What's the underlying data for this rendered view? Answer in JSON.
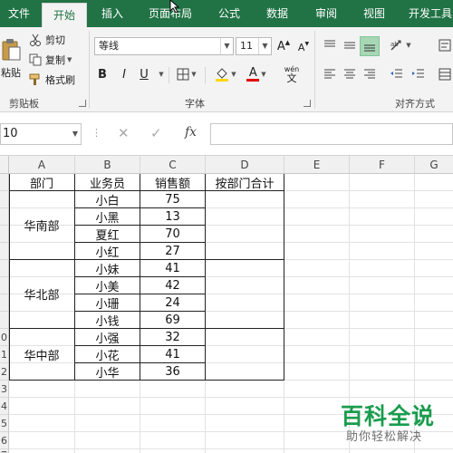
{
  "tabs": [
    "文件",
    "开始",
    "插入",
    "页面布局",
    "公式",
    "数据",
    "审阅",
    "视图",
    "开发工具"
  ],
  "clipboard": {
    "paste_label": "粘贴",
    "cut_label": "剪切",
    "copy_label": "复制",
    "format_painter_label": "格式刷",
    "group_label": "剪贴板"
  },
  "font": {
    "name": "等线",
    "size": "11",
    "bold": "B",
    "italic": "I",
    "underline": "U",
    "grow": "A",
    "shrink": "A",
    "wen": "wén",
    "wen_char": "文",
    "group_label": "字体",
    "color_letter": "A"
  },
  "alignment": {
    "group_label": "对齐方式"
  },
  "colors": {
    "fill": "#FFD700",
    "font": "#E00000",
    "accent": "#217346"
  },
  "formula_bar": {
    "name_box": "10",
    "fx": "fx",
    "cancel": "✕",
    "enter": "✓",
    "formula": ""
  },
  "columns": [
    "A",
    "B",
    "C",
    "D",
    "E",
    "F",
    "G"
  ],
  "rows": [
    "",
    "",
    "",
    "",
    "",
    "",
    "",
    "",
    "",
    "0",
    "1",
    "2",
    "3",
    "4",
    "5",
    "6",
    "7"
  ],
  "table": {
    "headers": [
      "部门",
      "业务员",
      "销售额",
      "按部门合计"
    ],
    "groups": [
      {
        "dept": "华南部",
        "rows": [
          [
            "小白",
            "75"
          ],
          [
            "小黑",
            "13"
          ],
          [
            "夏红",
            "70"
          ],
          [
            "小红",
            "27"
          ]
        ]
      },
      {
        "dept": "华北部",
        "rows": [
          [
            "小妹",
            "41"
          ],
          [
            "小美",
            "42"
          ],
          [
            "小珊",
            "24"
          ],
          [
            "小钱",
            "69"
          ]
        ]
      },
      {
        "dept": "华中部",
        "rows": [
          [
            "小强",
            "32"
          ],
          [
            "小花",
            "41"
          ],
          [
            "小华",
            "36"
          ]
        ]
      }
    ]
  },
  "watermark": {
    "main": "百科全说",
    "sub": "助你轻松解决"
  }
}
